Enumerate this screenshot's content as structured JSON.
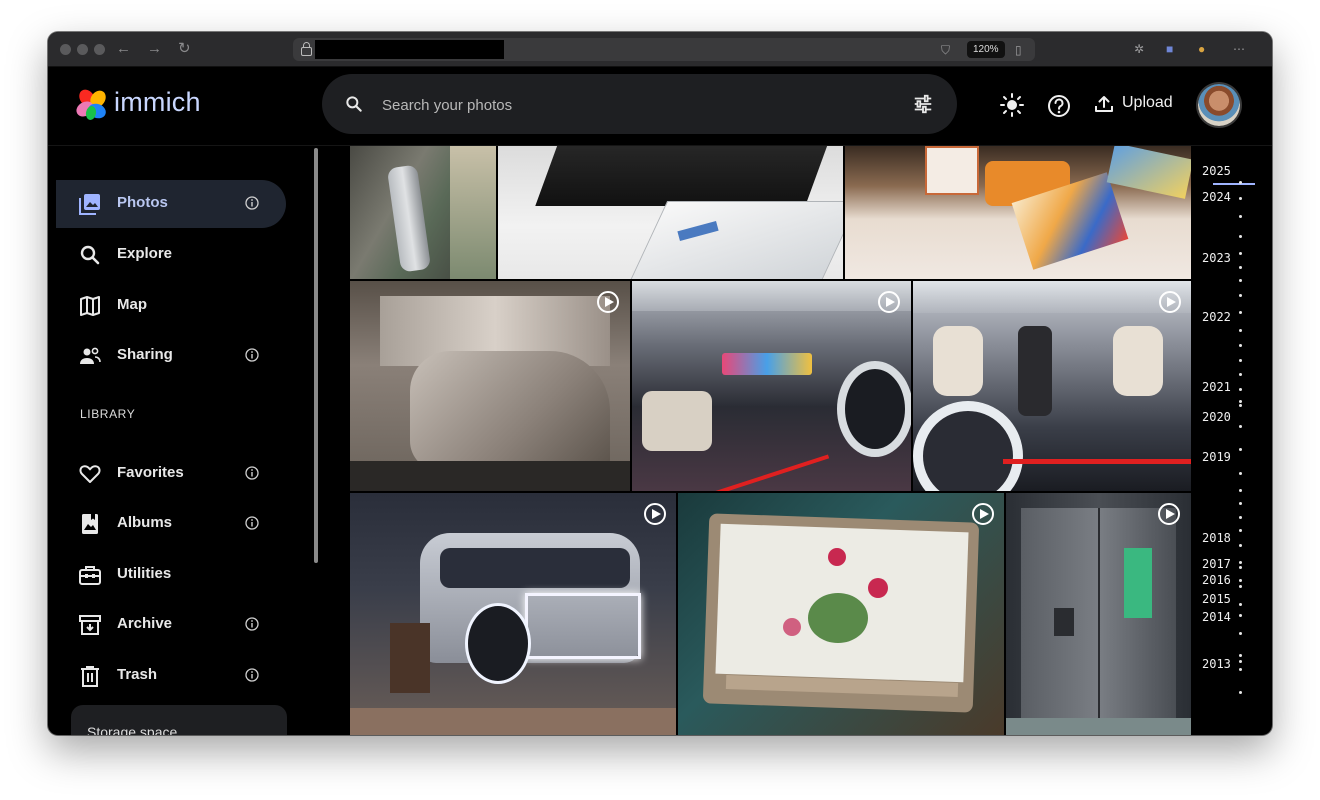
{
  "browser": {
    "zoom": "120%",
    "url_redacted": true
  },
  "app": {
    "name": "immich"
  },
  "search": {
    "placeholder": "Search your photos"
  },
  "header": {
    "upload_label": "Upload"
  },
  "sidebar": {
    "items": [
      {
        "label": "Photos",
        "icon": "photos-icon",
        "active": true,
        "info": true
      },
      {
        "label": "Explore",
        "icon": "search-icon",
        "active": false,
        "info": false
      },
      {
        "label": "Map",
        "icon": "map-icon",
        "active": false,
        "info": false
      },
      {
        "label": "Sharing",
        "icon": "sharing-icon",
        "active": false,
        "info": true
      }
    ],
    "library_heading": "LIBRARY",
    "library_items": [
      {
        "label": "Favorites",
        "icon": "heart-icon",
        "info": true
      },
      {
        "label": "Albums",
        "icon": "album-icon",
        "info": true
      },
      {
        "label": "Utilities",
        "icon": "toolbox-icon",
        "info": false
      },
      {
        "label": "Archive",
        "icon": "archive-icon",
        "info": true
      },
      {
        "label": "Trash",
        "icon": "trash-icon",
        "info": true
      }
    ],
    "storage_label": "Storage space"
  },
  "timeline": {
    "years": [
      "2025",
      "2024",
      "2023",
      "2022",
      "2021",
      "2020",
      "2019",
      "2018",
      "2017",
      "2016",
      "2015",
      "2014",
      "2013"
    ]
  },
  "photos": [
    {
      "name": "parking-garage-car",
      "video": false
    },
    {
      "name": "mini-pc-display-card",
      "video": false
    },
    {
      "name": "robot-toy-books",
      "video": false
    },
    {
      "name": "massage-chair-booth",
      "video": true
    },
    {
      "name": "concept-vehicle-interior",
      "video": true
    },
    {
      "name": "concept-vehicle-passenger",
      "video": true
    },
    {
      "name": "autonomous-shuttle-concept",
      "video": true
    },
    {
      "name": "flower-painting-screen",
      "video": true
    },
    {
      "name": "smart-refrigerator",
      "video": true
    }
  ],
  "colors": {
    "accent": "#9fb4ff",
    "active_bg": "#1f2530",
    "panel": "#1e1f22"
  }
}
